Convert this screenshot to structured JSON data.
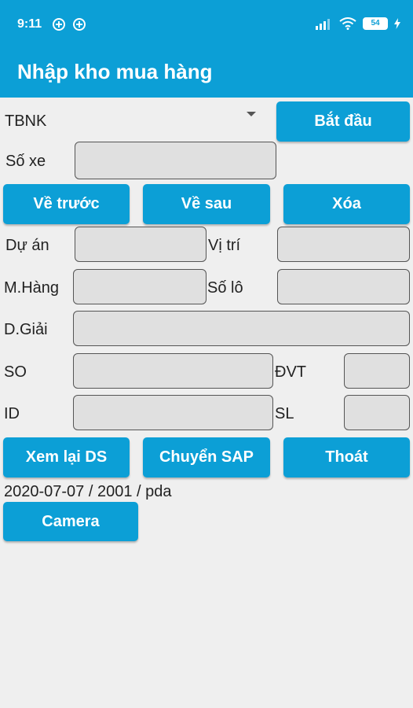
{
  "status_bar": {
    "time": "9:11",
    "battery": "54"
  },
  "app_bar": {
    "title": "Nhập kho mua hàng"
  },
  "spinner": {
    "selected": "TBNK"
  },
  "buttons": {
    "start": "Bắt đầu",
    "previous": "Về trước",
    "next": "Về sau",
    "delete": "Xóa",
    "review_list": "Xem lại DS",
    "transfer_sap": "Chuyển SAP",
    "exit": "Thoát",
    "camera": "Camera"
  },
  "labels": {
    "vehicle_no": "Số xe",
    "project": "Dự án",
    "location": "Vị trí",
    "item_code": "M.Hàng",
    "lot_no": "Số lô",
    "description": "D.Giải",
    "so": "SO",
    "unit": "ĐVT",
    "id": "ID",
    "quantity": "SL"
  },
  "fields": {
    "vehicle_no": "",
    "project": "",
    "location": "",
    "item_code": "",
    "lot_no": "",
    "description": "",
    "so": "",
    "unit": "",
    "id": "",
    "quantity": ""
  },
  "footer": {
    "info": "2020-07-07 / 2001 / pda"
  },
  "colors": {
    "primary": "#0c9fd6",
    "background": "#efefef",
    "field": "#e0e0e0"
  }
}
